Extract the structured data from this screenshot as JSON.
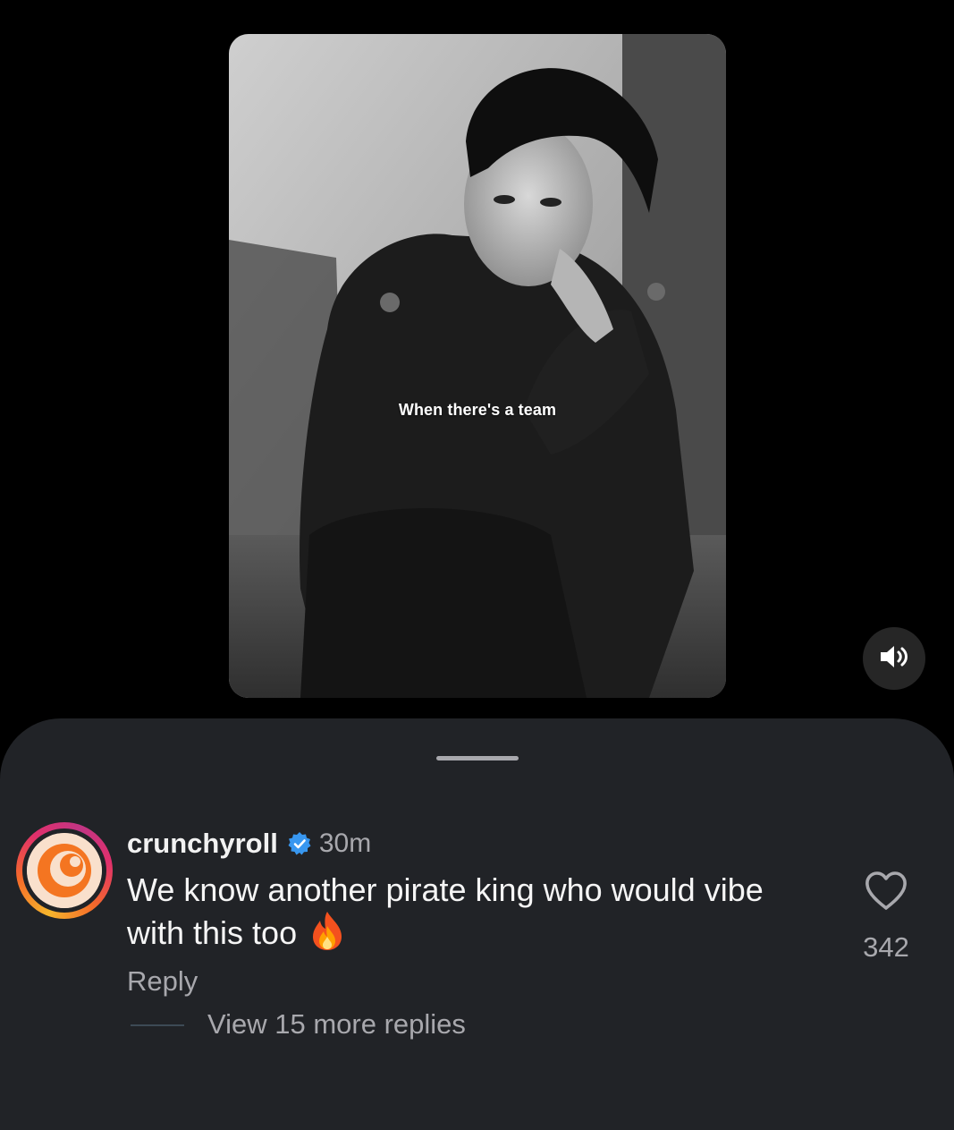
{
  "video": {
    "caption": "When there's a team",
    "sound_icon": "speaker-volume-icon"
  },
  "comment": {
    "username": "crunchyroll",
    "verified_icon": "verified-badge-icon",
    "timestamp": "30m",
    "text": "We know another pirate king who would vibe with this too",
    "emoji": "fire-emoji",
    "reply_label": "Reply",
    "view_replies_label": "View 15 more replies",
    "like_icon": "heart-outline-icon",
    "like_count": "342"
  },
  "colors": {
    "background": "#000000",
    "sheet": "#212327",
    "secondary_text": "#a8a8ad",
    "verified_blue": "#3897f0",
    "crunchyroll_orange": "#f47521"
  }
}
